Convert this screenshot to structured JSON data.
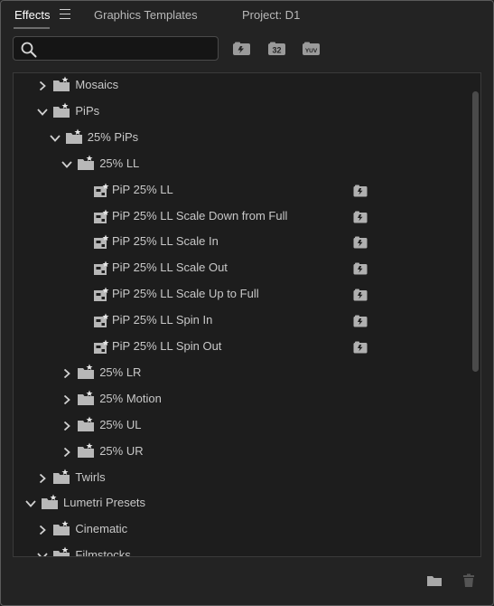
{
  "tabs": [
    {
      "label": "Effects"
    },
    {
      "label": "Graphics Templates"
    },
    {
      "label": "Project: D1"
    }
  ],
  "search": {
    "value": "",
    "placeholder": ""
  },
  "filters": {
    "accelerated_icon": "accelerated-effects-icon",
    "bit32_label": "32",
    "yuv_label": "YUV"
  },
  "tree": [
    {
      "label": "Mosaics",
      "type": "folder",
      "level": 1,
      "expanded": false
    },
    {
      "label": "PiPs",
      "type": "folder",
      "level": 1,
      "expanded": true
    },
    {
      "label": "25% PiPs",
      "type": "folder",
      "level": 2,
      "expanded": true
    },
    {
      "label": "25% LL",
      "type": "folder",
      "level": 3,
      "expanded": true
    },
    {
      "label": "PiP 25% LL",
      "type": "preset",
      "level": 4,
      "accelerated": true
    },
    {
      "label": "PiP 25% LL Scale Down from Full",
      "type": "preset",
      "level": 4,
      "accelerated": true
    },
    {
      "label": "PiP 25% LL Scale In",
      "type": "preset",
      "level": 4,
      "accelerated": true
    },
    {
      "label": "PiP 25% LL Scale Out",
      "type": "preset",
      "level": 4,
      "accelerated": true
    },
    {
      "label": "PiP 25% LL Scale Up to Full",
      "type": "preset",
      "level": 4,
      "accelerated": true
    },
    {
      "label": "PiP 25% LL Spin In",
      "type": "preset",
      "level": 4,
      "accelerated": true
    },
    {
      "label": "PiP 25% LL Spin Out",
      "type": "preset",
      "level": 4,
      "accelerated": true
    },
    {
      "label": "25% LR",
      "type": "folder",
      "level": 3,
      "expanded": false
    },
    {
      "label": "25% Motion",
      "type": "folder",
      "level": 3,
      "expanded": false
    },
    {
      "label": "25% UL",
      "type": "folder",
      "level": 3,
      "expanded": false
    },
    {
      "label": "25% UR",
      "type": "folder",
      "level": 3,
      "expanded": false
    },
    {
      "label": "Twirls",
      "type": "folder",
      "level": 1,
      "expanded": false
    },
    {
      "label": "Lumetri Presets",
      "type": "folder",
      "level": 0,
      "expanded": true
    },
    {
      "label": "Cinematic",
      "type": "folder",
      "level": 1,
      "expanded": false
    },
    {
      "label": "Filmstocks",
      "type": "folder",
      "level": 1,
      "expanded": true
    }
  ],
  "footer": {
    "new_bin_icon": "folder-icon",
    "delete_icon": "trash-icon"
  },
  "colors": {
    "background": "#232323",
    "list_background": "#1d1d1d",
    "text": "#c8c8c8",
    "icon": "#c8c8c8"
  }
}
